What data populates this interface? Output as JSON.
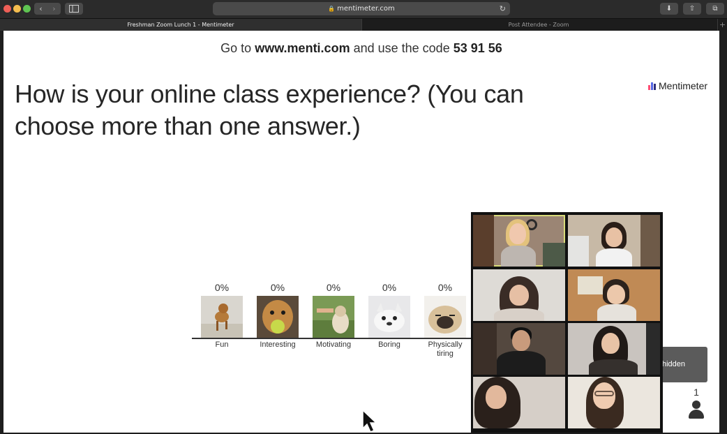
{
  "browser": {
    "url": "mentimeter.com",
    "tabs": [
      {
        "label": "Freshman Zoom Lunch 1 - Mentimeter",
        "active": true
      },
      {
        "label": "Post Attendee - Zoom",
        "active": false
      }
    ]
  },
  "presentation": {
    "instruction_prefix": "Go to",
    "instruction_site": "www.menti.com",
    "instruction_middle": "and use the code",
    "instruction_code": "53 91 56",
    "brand": "Mentimeter",
    "question": "How is your online class experience? (You can choose more than one answer.)",
    "hidden_pill_text": "hidden",
    "vote_count": "1"
  },
  "chart_data": {
    "type": "bar",
    "categories": [
      "Fun",
      "Interesting",
      "Motivating",
      "Boring",
      "Physically tiring"
    ],
    "values": [
      0,
      0,
      0,
      0,
      0
    ],
    "value_labels": [
      "0%",
      "0%",
      "0%",
      "0%",
      "0%"
    ]
  },
  "colors": {
    "menti_brand": [
      "#ff4c73",
      "#5769e7",
      "#2d2d7a"
    ],
    "active_speaker_outline": "#d9dc7a"
  },
  "icons": {
    "back": "chevron-left-icon",
    "forward": "chevron-right-icon",
    "sidebar": "sidebar-icon",
    "lock": "lock-icon",
    "reload": "reload-icon",
    "download": "download-icon",
    "share": "share-icon",
    "tabs": "tab-overview-icon",
    "voter": "person-icon"
  }
}
